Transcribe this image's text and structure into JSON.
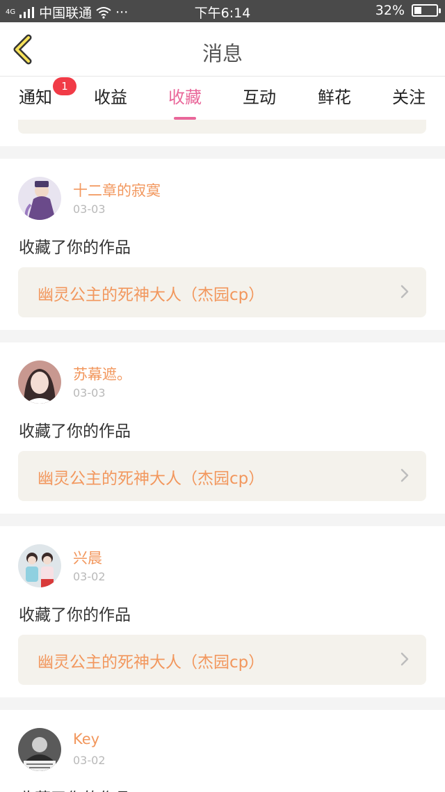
{
  "status_bar": {
    "network": "4G",
    "carrier": "中国联通",
    "dots": "···",
    "time": "下午6:14",
    "battery_percent": "32%",
    "battery_level": 0.32
  },
  "header": {
    "title": "消息"
  },
  "tabs": [
    {
      "label": "通知",
      "badge": "1"
    },
    {
      "label": "收益"
    },
    {
      "label": "收藏",
      "active": true
    },
    {
      "label": "互动"
    },
    {
      "label": "鲜花"
    },
    {
      "label": "关注"
    }
  ],
  "colors": {
    "accent_pink": "#e9679a",
    "username_orange": "#f2975d",
    "badge_red": "#f13b47"
  },
  "items": [
    {
      "username": "十二章的寂寞",
      "date": "03-03",
      "action": "收藏了你的作品",
      "work_title": "幽灵公主的死神大人（杰园cp）"
    },
    {
      "username": "苏幕遮。",
      "date": "03-03",
      "action": "收藏了你的作品",
      "work_title": "幽灵公主的死神大人（杰园cp）"
    },
    {
      "username": "兴晨",
      "date": "03-02",
      "action": "收藏了你的作品",
      "work_title": "幽灵公主的死神大人（杰园cp）"
    },
    {
      "username": "Key",
      "date": "03-02",
      "action": "收藏了你的作品",
      "work_title": ""
    }
  ]
}
